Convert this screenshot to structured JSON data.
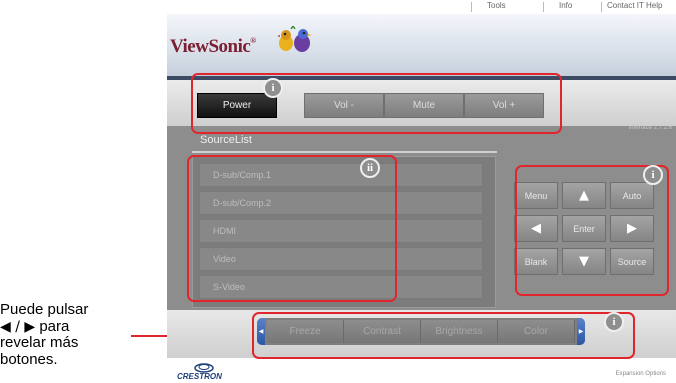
{
  "caption": {
    "line1": "Puede pulsar",
    "arrows": "◀ / ▶",
    "line2": "para",
    "line3": "revelar más",
    "line4": "botones."
  },
  "topbar": {
    "tools": "Tools",
    "info": "Info",
    "contact": "Contact IT Help"
  },
  "brand": {
    "name": "ViewSonic",
    "trademark": "®"
  },
  "power_bar": {
    "power": "Power",
    "vol_minus": "Vol -",
    "mute": "Mute",
    "vol_plus": "Vol +"
  },
  "interface_version": "Interface 2.7.2.6",
  "source_list": {
    "title": "SourceList",
    "items": [
      "D-sub/Comp.1",
      "D-sub/Comp.2",
      "HDMI",
      "Video",
      "S-Video"
    ]
  },
  "control_pad": {
    "menu": "Menu",
    "up": "▲",
    "auto": "Auto",
    "left": "◀",
    "enter": "Enter",
    "right": "▶",
    "blank": "Blank",
    "down": "▼",
    "source": "Source"
  },
  "toolbar": {
    "freeze": "Freeze",
    "contrast": "Contrast",
    "brightness": "Brightness",
    "color": "Color",
    "left_arrow": "◀",
    "right_arrow": "▶"
  },
  "footer": {
    "crestron": "CRESTRON",
    "expansion": "Expansion Options"
  },
  "badges": {
    "i": "i",
    "ii": "ii"
  },
  "colors": {
    "annotation": "#e0262c",
    "header_line": "#3c4b63",
    "brand": "#7b1f33",
    "crestron": "#1d3f7a"
  }
}
